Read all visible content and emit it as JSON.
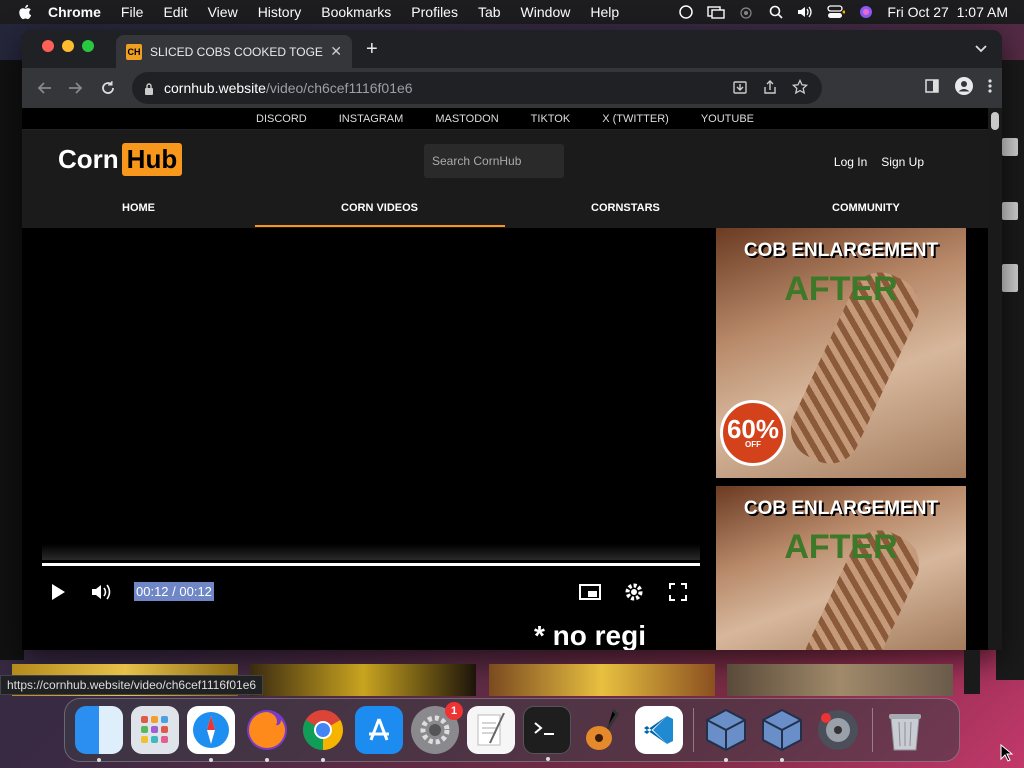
{
  "menubar": {
    "app": "Chrome",
    "items": [
      "File",
      "Edit",
      "View",
      "History",
      "Bookmarks",
      "Profiles",
      "Tab",
      "Window",
      "Help"
    ],
    "clock": "Fri Oct 27  1:07 AM"
  },
  "browser": {
    "tab_title": "SLICED COBS COOKED TOGE",
    "favicon_text": "CH",
    "url_host": "cornhub.website",
    "url_path": "/video/ch6cef1116f01e6"
  },
  "site": {
    "social_links": [
      "DISCORD",
      "INSTAGRAM",
      "MASTODON",
      "TIKTOK",
      "X (TWITTER)",
      "YOUTUBE"
    ],
    "logo_left": "Corn",
    "logo_right": "Hub",
    "search_placeholder": "Search CornHub",
    "login": "Log In",
    "signup": "Sign Up",
    "nav": [
      "HOME",
      "CORN VIDEOS",
      "CORNSTARS",
      "COMMUNITY"
    ],
    "active_nav": "CORN VIDEOS"
  },
  "player": {
    "time": "00:12 / 00:12",
    "progress": 1.0,
    "overlay_text": "* no regi"
  },
  "ads": [
    {
      "headline": "COB ENLARGEMENT",
      "after": "AFTER",
      "badge_pct": "60%",
      "badge_off": "OFF"
    },
    {
      "headline": "COB ENLARGEMENT",
      "after": "AFTER"
    }
  ],
  "status_url": "https://cornhub.website/video/ch6cef1116f01e6",
  "dock": {
    "settings_badge": "1"
  },
  "colors": {
    "accent_orange": "#f7971c",
    "time_highlight": "#6f87c7"
  }
}
